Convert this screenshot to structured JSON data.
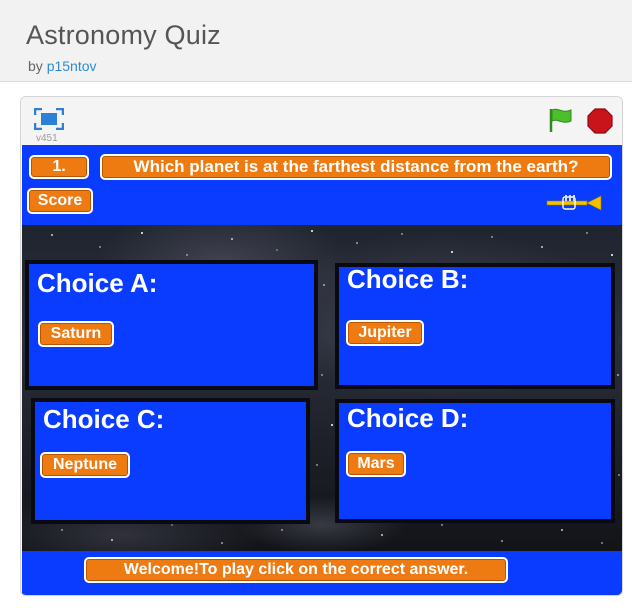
{
  "header": {
    "title": "Astronomy Quiz",
    "by_prefix": "by",
    "author": "p15ntov"
  },
  "player": {
    "version": "v451",
    "icons": {
      "fullscreen": "fullscreen-icon",
      "green_flag": "green-flag-icon",
      "stop": "stop-icon"
    },
    "colors": {
      "flag": "#4cbf2a",
      "stop": "#c8141a"
    }
  },
  "quiz": {
    "question_number": "1.",
    "question": "Which planet is at the farthest distance from the earth?",
    "score_label": "Score",
    "sound_icon": "trumpet-icon",
    "choices": [
      {
        "title": "Choice A:",
        "answer": "Saturn"
      },
      {
        "title": "Choice B:",
        "answer": "Jupiter"
      },
      {
        "title": "Choice C:",
        "answer": "Neptune"
      },
      {
        "title": "Choice D:",
        "answer": "Mars"
      }
    ],
    "message": "Welcome!To play click on the correct answer.",
    "colors": {
      "stage_blue": "#0a3cff",
      "pill_orange": "#ee7a12"
    }
  }
}
